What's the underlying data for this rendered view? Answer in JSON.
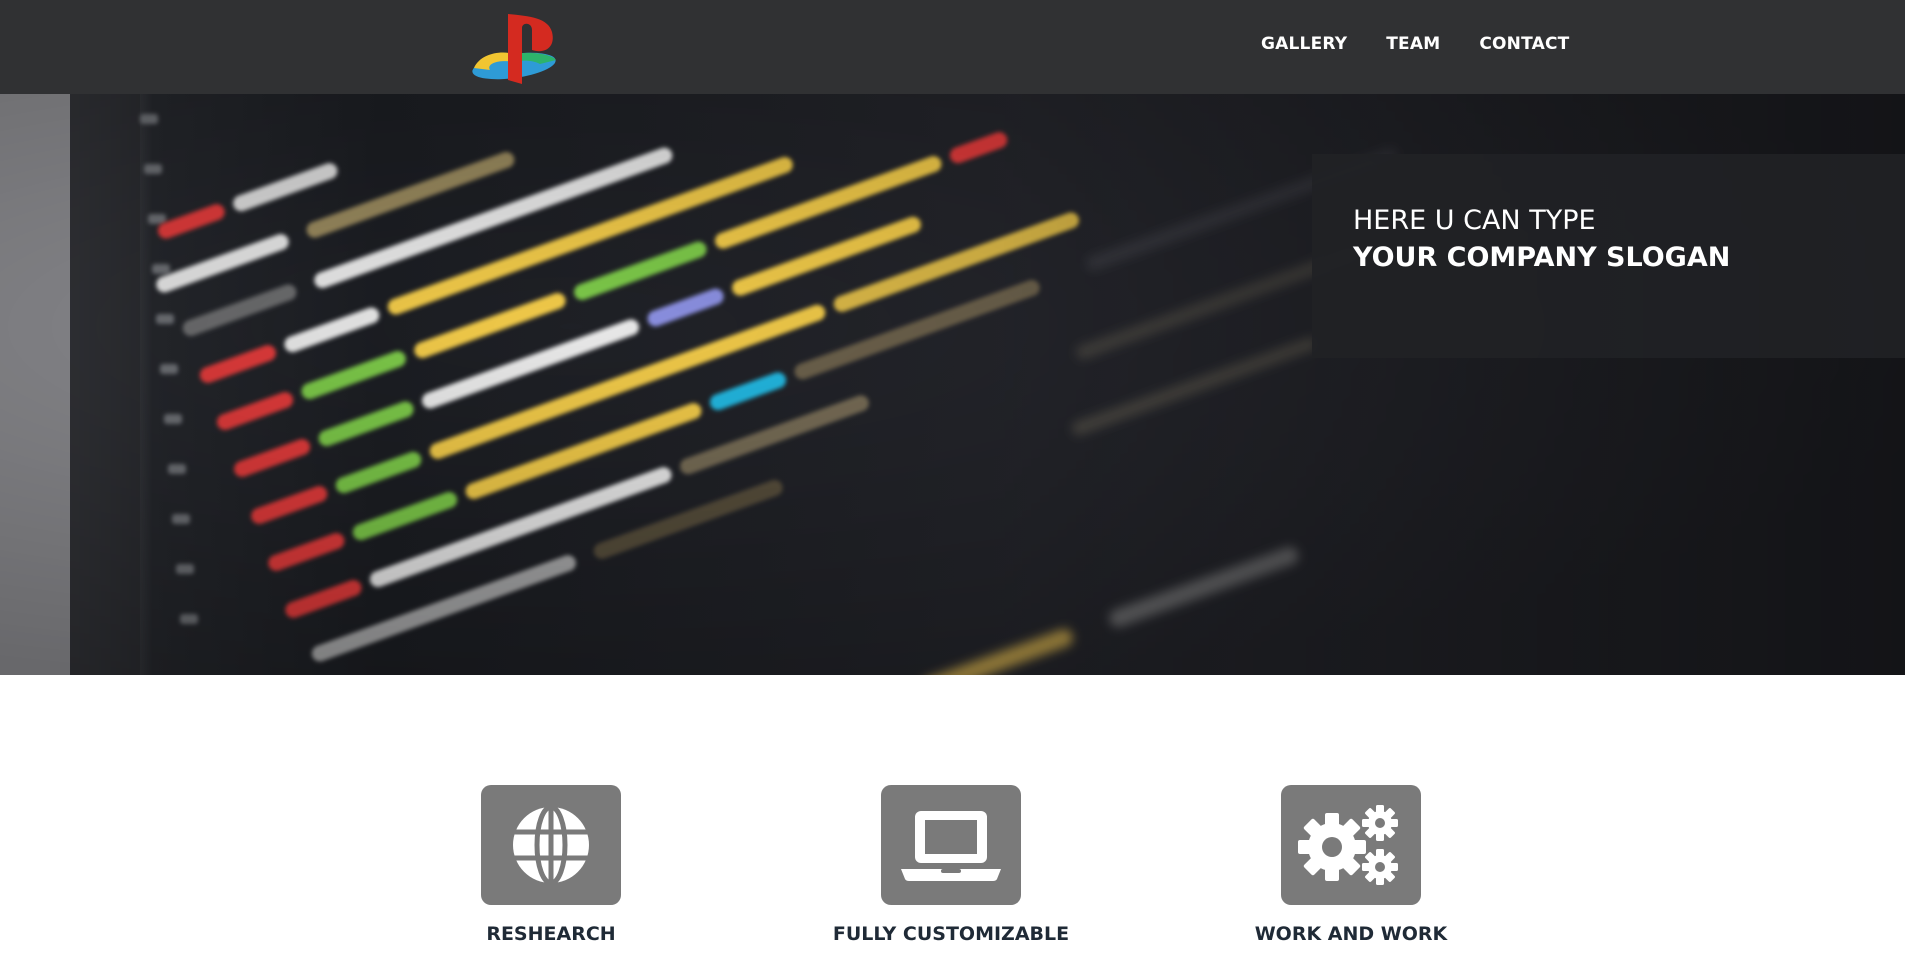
{
  "nav": {
    "logo": "playstation-logo",
    "items": [
      {
        "label": "GALLERY"
      },
      {
        "label": "TEAM"
      },
      {
        "label": "CONTACT"
      }
    ]
  },
  "hero": {
    "background": "blurred code on monitor",
    "slogan_line1": "HERE U CAN TYPE",
    "slogan_line2": "YOUR COMPANY SLOGAN"
  },
  "features": [
    {
      "title": "RESHEARCH",
      "icon": "globe-icon"
    },
    {
      "title": "FULLY CUSTOMIZABLE",
      "icon": "laptop-icon"
    },
    {
      "title": "WORK AND WORK",
      "icon": "gears-icon"
    }
  ],
  "colors": {
    "topbar": "#303133",
    "tile": "#7a7a7a",
    "feature_title": "#1f2a36"
  }
}
